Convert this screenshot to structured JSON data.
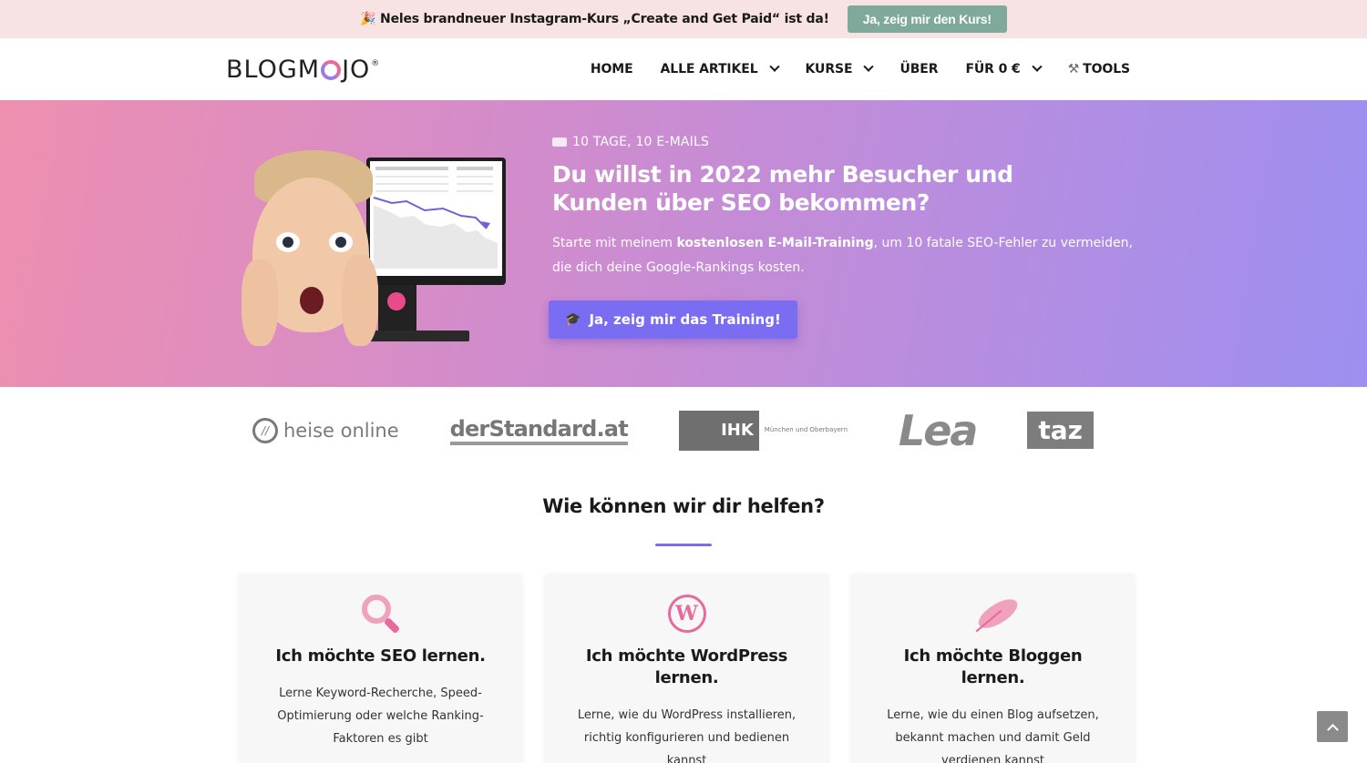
{
  "topbar": {
    "text": "🎉 Neles brandneuer Instagram-Kurs „Create and Get Paid“ ist da!",
    "button": "Ja, zeig mir den Kurs!"
  },
  "header": {
    "logo": "BLOGMOJO",
    "nav": [
      {
        "label": "HOME",
        "dropdown": false
      },
      {
        "label": "ALLE ARTIKEL",
        "dropdown": true
      },
      {
        "label": "KURSE",
        "dropdown": true
      },
      {
        "label": "ÜBER",
        "dropdown": false
      },
      {
        "label": "FÜR 0 €",
        "dropdown": true
      },
      {
        "label": "TOOLS",
        "dropdown": false,
        "icon": "tools-icon"
      }
    ]
  },
  "hero": {
    "eyebrow": "10 TAGE, 10 E-MAILS",
    "title": "Du willst in 2022 mehr Besucher und Kunden über SEO bekommen?",
    "sub_pre": "Starte mit meinem ",
    "sub_bold": "kostenlosen E-Mail-Training",
    "sub_post": ", um 10 fatale SEO-Fehler zu vermeiden, die dich deine Google-Rankings kosten.",
    "button": "Ja, zeig mir das Training!"
  },
  "press_logos": {
    "heise": "heise online",
    "standard": "derStandard.at",
    "ihk": "IHK",
    "ihk_sub": "München und Oberbayern",
    "lea": "Lea",
    "taz": "taz"
  },
  "section": {
    "title": "Wie können wir dir helfen?"
  },
  "cards": [
    {
      "icon": "search-icon",
      "title": "Ich möchte SEO lernen.",
      "text": "Lerne Keyword-Recherche, Speed-Optimierung oder welche Ranking-Faktoren es gibt"
    },
    {
      "icon": "wordpress-icon",
      "title": "Ich möchte WordPress lernen.",
      "text": "Lerne, wie du WordPress installieren, richtig konfigurieren und bedienen kannst"
    },
    {
      "icon": "feather-icon",
      "title": "Ich möchte Bloggen lernen.",
      "text": "Lerne, wie du einen Blog aufsetzen, bekannt machen und damit Geld verdienen kannst"
    }
  ],
  "colors": {
    "accent": "#7b6df2",
    "pink": "#e66a9d",
    "topbar_bg": "#f7e3e3",
    "topbar_button": "#7fa99b"
  }
}
